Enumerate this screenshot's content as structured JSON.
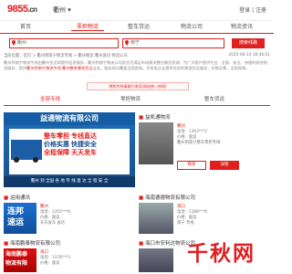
{
  "header": {
    "logo": "9855",
    "logo_suffix": ".cn",
    "city": "衢州",
    "right_links": "登录 | 注册"
  },
  "nav": {
    "items": [
      {
        "label": "首页"
      },
      {
        "label": "零担物流"
      },
      {
        "label": "整车货运"
      },
      {
        "label": "物流公司"
      },
      {
        "label": "物流资讯"
      }
    ],
    "active_index": 1
  },
  "search": {
    "from_value": "衢州",
    "to_placeholder": "南宁",
    "button": "搜索线路"
  },
  "breadcrumb": {
    "text": "当前位置：首页 > 衢州到南宁物流专线 > 衢州物流 衢州直达 物流公司",
    "date": "2025-06-24 18:46:01"
  },
  "intro": {
    "text_a": "衢州到南宁物流专线由衢州货运网提供信息服务，衢州到南宁物流公司发货为满足市场需求整合最优资源，为广大客户提供专业、全面、安全、快捷的综合物流服务，提供",
    "red": "衢州到南宁物流专线 衢州整车零担货运",
    "text_b": "业务，服务网点覆盖全国各地。为各类企业提供优质的物流货运服务，价格实惠，全程保障。"
  },
  "notice": "想找专线请拨打电话(网站统一热线)",
  "tabs": [
    {
      "label": "全部专线"
    },
    {
      "label": "零担物流"
    },
    {
      "label": "整车货运"
    }
  ],
  "featured": {
    "banner_title": "益通物流有限公司",
    "lines": [
      "整车零担 专线直达",
      "价格实惠 快捷安全",
      "全程保障 天天发车"
    ],
    "footer": "衢州 到 全国 各 地 专 线 直 达 全 程 安 全"
  },
  "sections": {
    "top_right_title": "益凯通物流",
    "mid_left_title": "运用通讯",
    "mid_right_title": "海南德德物流有限公司",
    "bottom_left_title": "海南鹏泰物流有限公司",
    "bottom_right_title": "海口市安利达物流公司"
  },
  "listings": [
    {
      "city": "衢州",
      "line": "电话：1363***2",
      "price": "价格：面议",
      "desc": "衢州到南宁整车零担专线"
    },
    {
      "city": "衢州",
      "line": "电话：1355***8",
      "price": "价格：面议",
      "desc": "天天发车 直达"
    },
    {
      "city": "海口",
      "line": "电话：1388***6",
      "price": "价格：面议",
      "desc": "南宁 专线"
    },
    {
      "city": "海口",
      "line": "电话：1378***3",
      "price": "价格：面议",
      "desc": "海口到南宁 物流专线"
    }
  ],
  "buttons": {
    "call": "联系",
    "detail": "详情"
  },
  "badge": {
    "left1": "连邦",
    "left2": "速运",
    "red1": "海南鹏泰",
    "red2": "物流有限"
  },
  "watermark": "千秋网",
  "colors": {
    "accent": "#e02020",
    "banner_blue": "#1a4f8e"
  }
}
